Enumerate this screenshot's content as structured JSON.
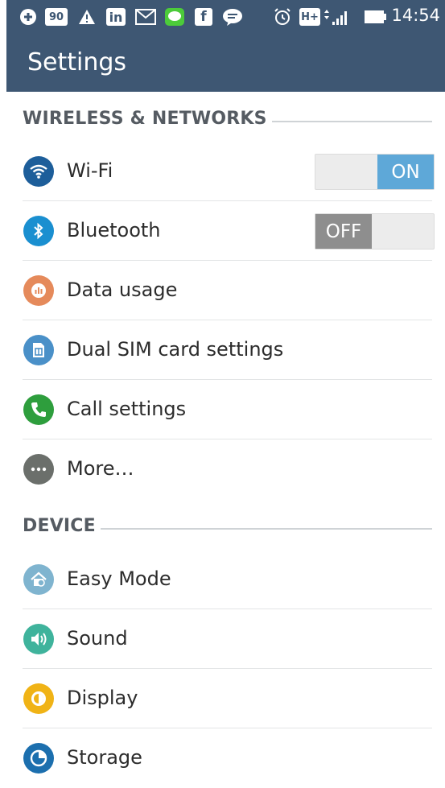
{
  "status_bar": {
    "notification_icons": [
      "plus-icon",
      "90-badge-icon",
      "warning-icon",
      "linkedin-icon",
      "mail-icon",
      "line-app-icon",
      "facebook-icon",
      "chat-bubble-icon"
    ],
    "badge_90_text": "90",
    "linkedin_text": "in",
    "facebook_text": "f",
    "network_type": "H+",
    "time": "14:54"
  },
  "app_bar": {
    "title": "Settings"
  },
  "sections": [
    {
      "header": "WIRELESS & NETWORKS"
    },
    {
      "header": "DEVICE"
    }
  ],
  "items": {
    "wifi": {
      "label": "Wi-Fi",
      "toggle": "ON",
      "toggle_on": true,
      "icon": "wifi-icon",
      "color": "#1d5e9a"
    },
    "bluetooth": {
      "label": "Bluetooth",
      "toggle": "OFF",
      "toggle_on": false,
      "icon": "bluetooth-icon",
      "color": "#1a8fd0"
    },
    "data_usage": {
      "label": "Data usage",
      "icon": "data-usage-icon",
      "color": "#e58a5b"
    },
    "dual_sim": {
      "label": "Dual SIM card settings",
      "icon": "sim-card-icon",
      "color": "#4a90c8"
    },
    "call": {
      "label": "Call settings",
      "icon": "phone-icon",
      "color": "#2e9e3d"
    },
    "more": {
      "label": "More…",
      "icon": "more-icon",
      "color": "#6b6f6b"
    },
    "easy_mode": {
      "label": "Easy Mode",
      "icon": "easy-mode-icon",
      "color": "#7fb4cf"
    },
    "sound": {
      "label": "Sound",
      "icon": "speaker-icon",
      "color": "#3fb39c"
    },
    "display": {
      "label": "Display",
      "icon": "brightness-icon",
      "color": "#f0b316"
    },
    "storage": {
      "label": "Storage",
      "icon": "storage-icon",
      "color": "#1c6fae"
    }
  },
  "colors": {
    "accent": "#3e5773",
    "toggle_on": "#5ea8d8",
    "toggle_off": "#8e8e8e"
  }
}
